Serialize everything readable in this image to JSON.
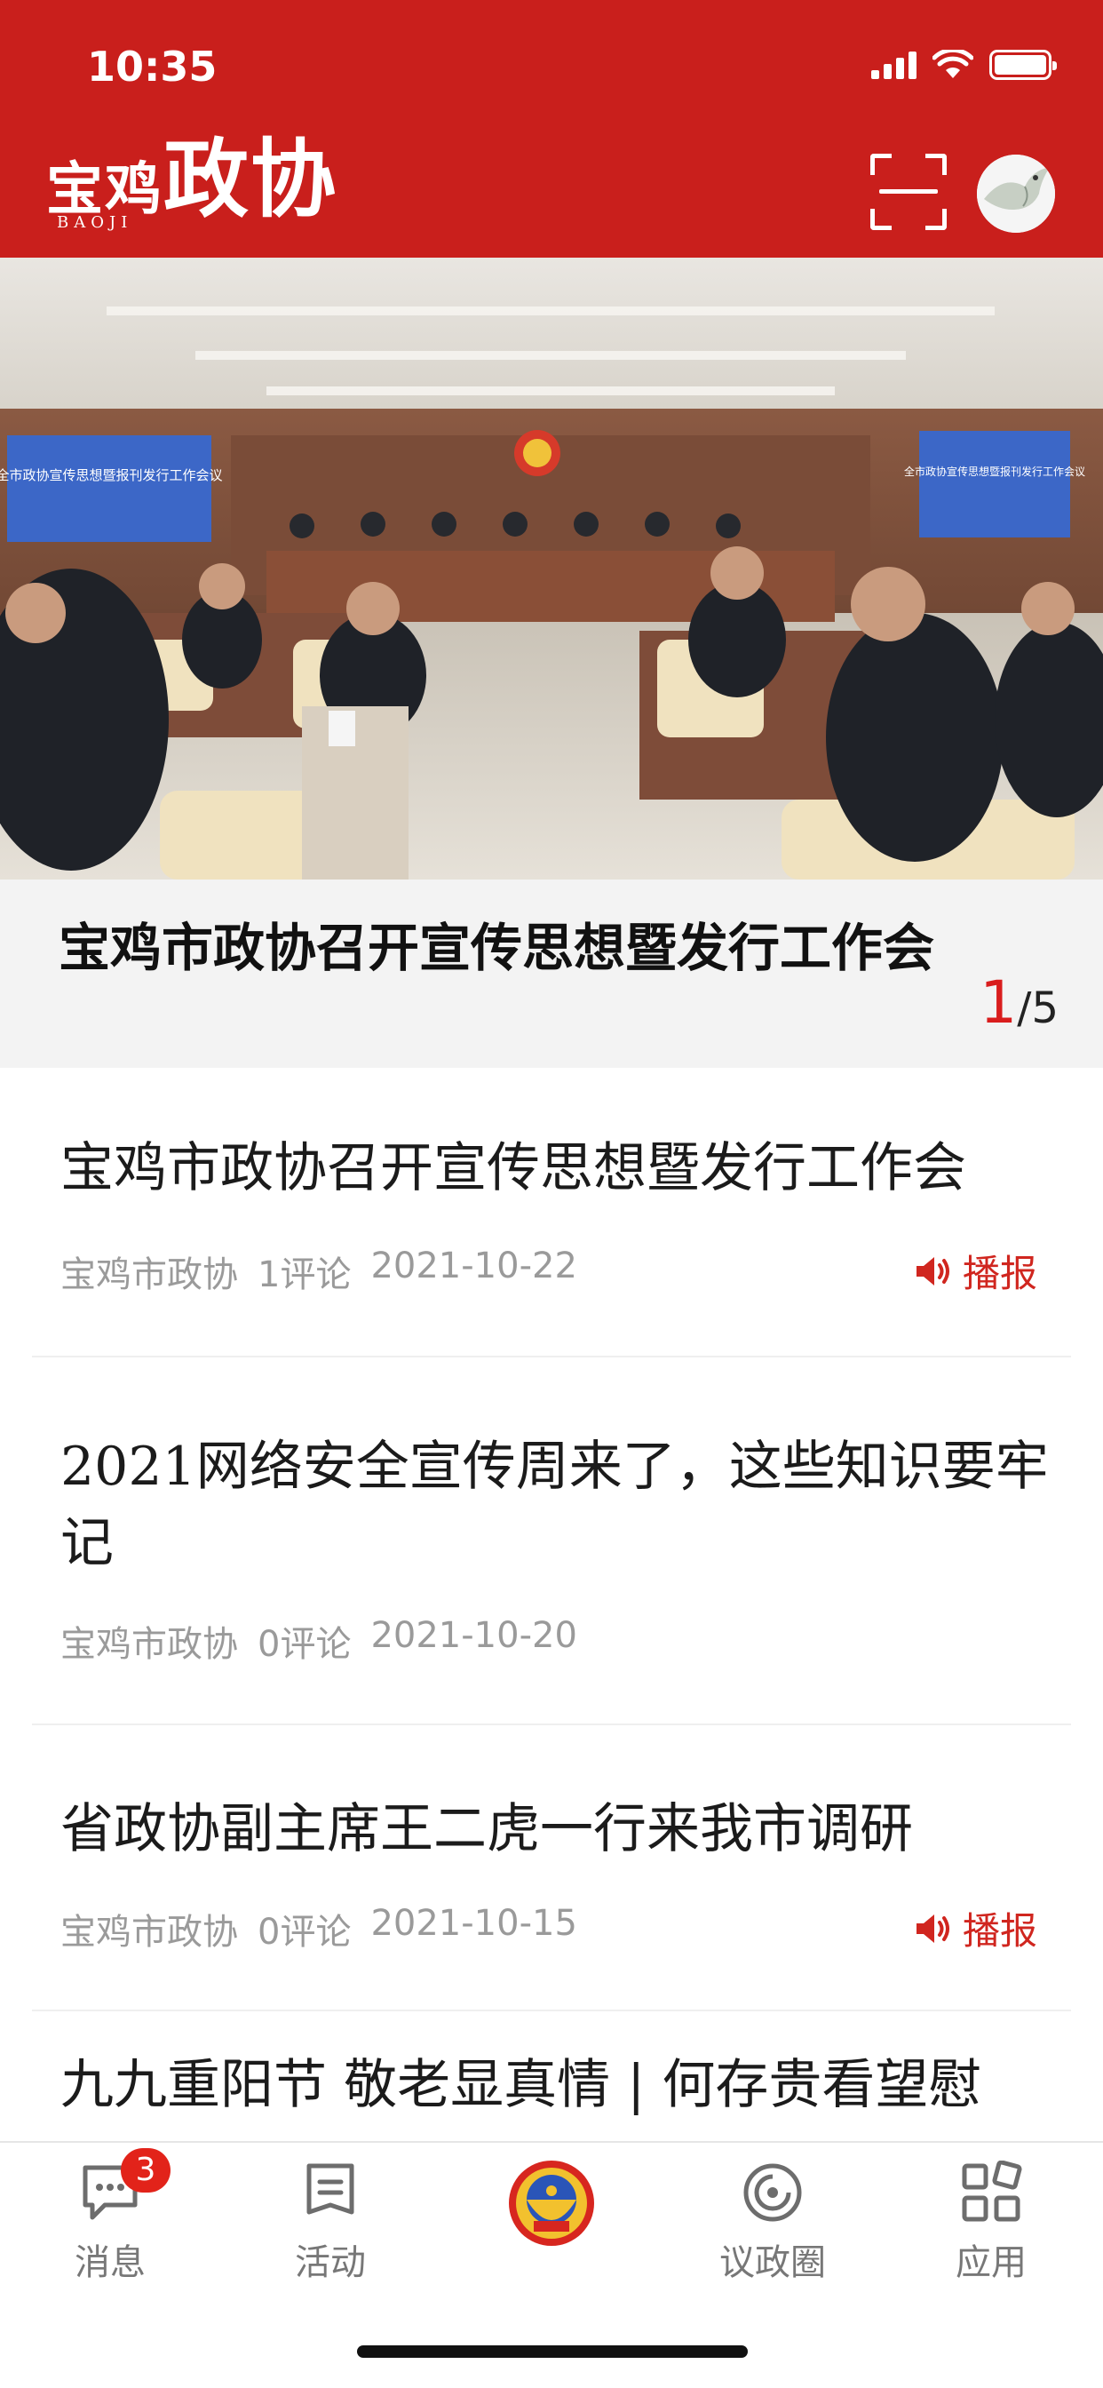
{
  "status_bar": {
    "time": "10:35"
  },
  "app": {
    "logo_part1": "宝鸡",
    "logo_part2": "政协",
    "logo_en": "BAOJI",
    "brand_color": "#c91f1c"
  },
  "banner": {
    "image_screen_text": "全市政协宣传思想暨报刊发行工作会议",
    "title": "宝鸡市政协召开宣传思想暨发行工作会",
    "pager_current": "1",
    "pager_total": "/5"
  },
  "news": [
    {
      "title": "宝鸡市政协召开宣传思想暨发行工作会",
      "source": "宝鸡市政协",
      "comments": "1评论",
      "date": "2021-10-22",
      "broadcast": "播报"
    },
    {
      "title": "2021网络安全宣传周来了，这些知识要牢记",
      "source": "宝鸡市政协",
      "comments": "0评论",
      "date": "2021-10-20"
    },
    {
      "title": "省政协副主席王二虎一行来我市调研",
      "source": "宝鸡市政协",
      "comments": "0评论",
      "date": "2021-10-15",
      "broadcast": "播报"
    },
    {
      "title": "九九重阳节 敬老显真情 | 何存贵看望慰"
    }
  ],
  "tabs": [
    {
      "label": "消息",
      "badge": "3",
      "icon": "message-icon"
    },
    {
      "label": "活动",
      "icon": "activity-icon"
    },
    {
      "label": "",
      "icon": "cppcc-emblem-icon"
    },
    {
      "label": "议政圈",
      "icon": "circle-icon"
    },
    {
      "label": "应用",
      "icon": "apps-icon"
    }
  ]
}
